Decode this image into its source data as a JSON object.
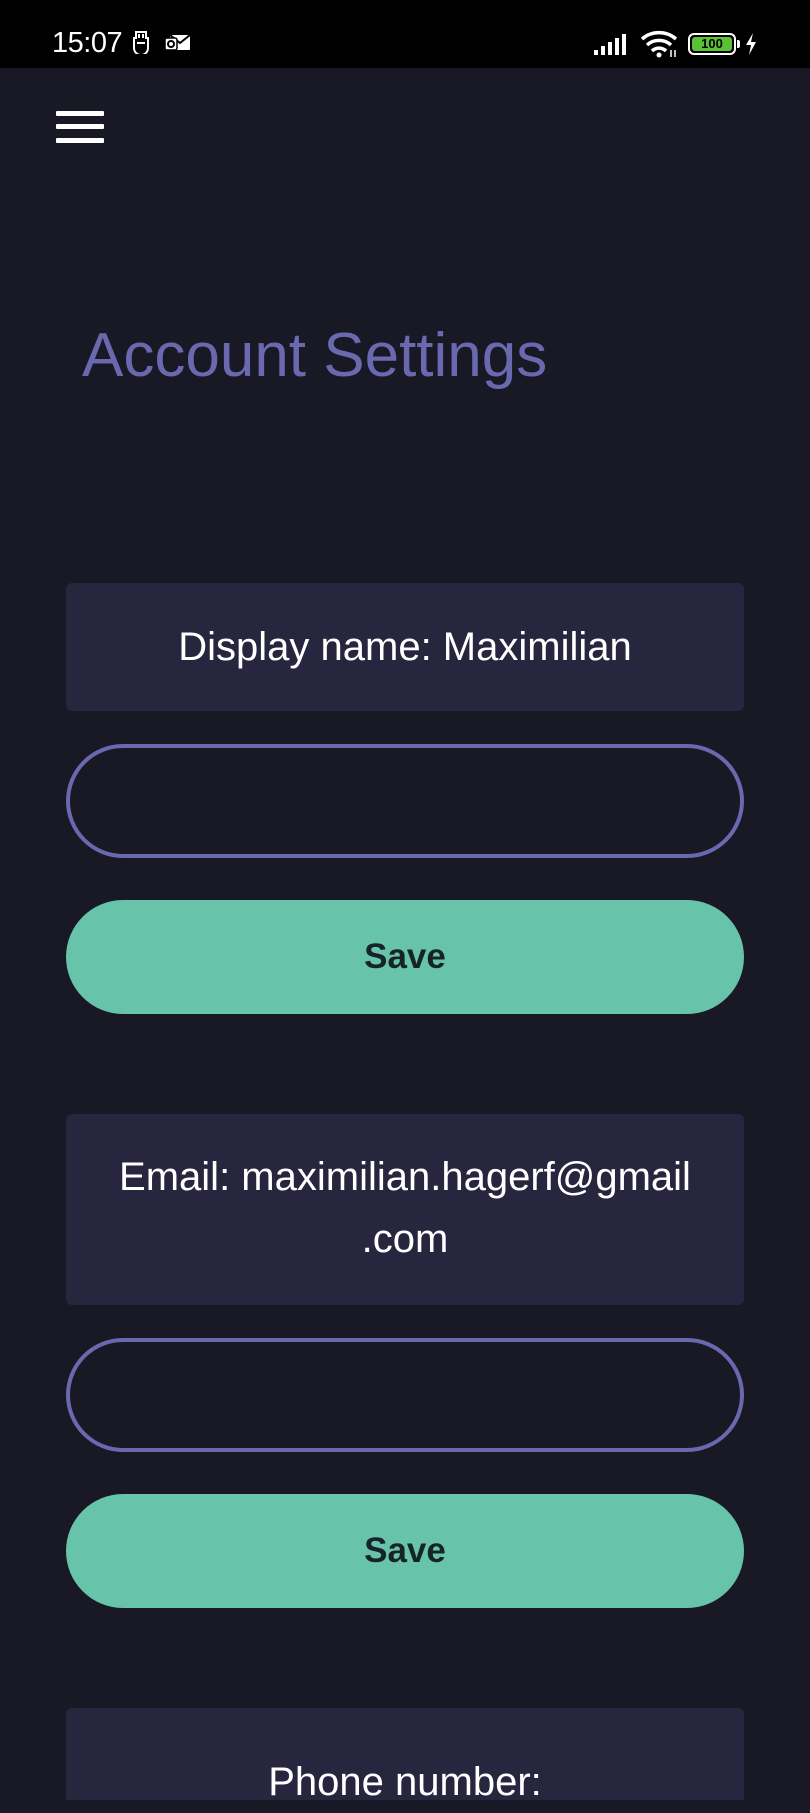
{
  "status_bar": {
    "time": "15:07",
    "battery_level": "100",
    "icons": [
      "usb-icon",
      "mail-notification-icon",
      "signal-icon",
      "wifi-icon",
      "battery-icon",
      "charging-icon"
    ]
  },
  "header": {
    "menu_icon": "hamburger-menu-icon"
  },
  "page": {
    "title": "Account Settings"
  },
  "display_name": {
    "label": "Display name: Maximilian",
    "input_value": "",
    "input_placeholder": "",
    "save_label": "Save"
  },
  "email": {
    "label_line1": "Email: maximilian.hagerf@gmail",
    "label_line2": ".com",
    "input_value": "",
    "input_placeholder": "",
    "save_label": "Save"
  },
  "phone": {
    "label": "Phone number:"
  },
  "colors": {
    "background": "#191825",
    "accent": "#6a69b0",
    "card": "#27263e",
    "button": "#67c4ab",
    "button_text": "#17232a"
  }
}
